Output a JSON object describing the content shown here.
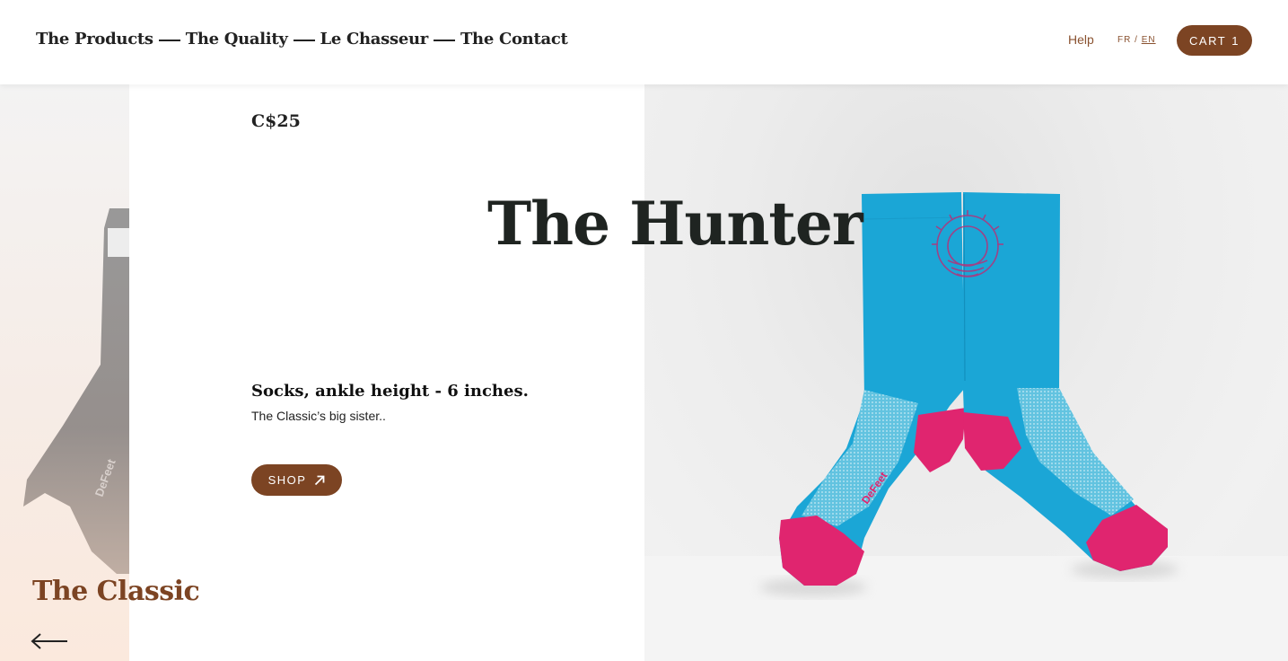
{
  "header": {
    "nav": [
      {
        "label": "The Products"
      },
      {
        "label": "The Quality"
      },
      {
        "label": "Le Chasseur"
      },
      {
        "label": "The Contact"
      }
    ],
    "help_label": "Help",
    "lang_fr": "FR",
    "lang_sep": "/",
    "lang_en": "EN",
    "cart_label": "CART",
    "cart_count": "1"
  },
  "product": {
    "price": "C$25",
    "title": "The Hunter",
    "subtitle": "Socks, ankle height - 6 inches.",
    "description": "The Classic’s big sister..",
    "shop_label": "SHOP",
    "image_brand": "DeFeet"
  },
  "previous": {
    "title": "The Classic",
    "image_brand": "DeFeet"
  },
  "colors": {
    "accent_brown": "#7c4423",
    "sock_blue": "#1ba6d6",
    "sock_magenta": "#e0256f",
    "text_dark": "#1f2421"
  },
  "icons": {
    "shop": "arrow-up-right-icon",
    "previous": "arrow-left-icon",
    "logo": "sunburst-logo-icon"
  }
}
